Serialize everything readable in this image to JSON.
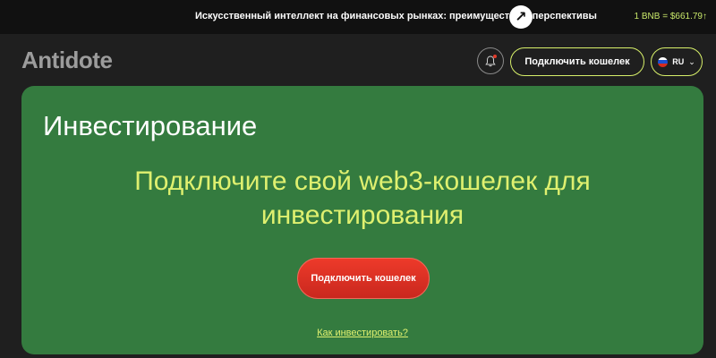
{
  "topbar": {
    "news_text": "Искусственный интеллект на финансовых рынках: преимущества и перспективы",
    "news_arrow_icon": "arrow-up-right-icon",
    "ticker": "1 BNB = $661.79↑"
  },
  "header": {
    "logo": "Antidote",
    "bell_icon": "bell-icon",
    "connect_label": "Подключить кошелек",
    "lang_code": "RU",
    "flag_icon": "russia-flag-icon",
    "lang_chevron_icon": "chevron-down-icon"
  },
  "main": {
    "title": "Инвестирование",
    "headline_line1": "Подключите свой web3-кошелек для",
    "headline_line2": "инвестирования",
    "connect_label": "Подключить кошелек",
    "how_link": "Как инвестировать?"
  },
  "colors": {
    "background": "#1f1f1f",
    "topbar": "#111111",
    "card": "#347b3f",
    "accent_lime": "#dff06f",
    "button_red": "#e33b2a"
  }
}
